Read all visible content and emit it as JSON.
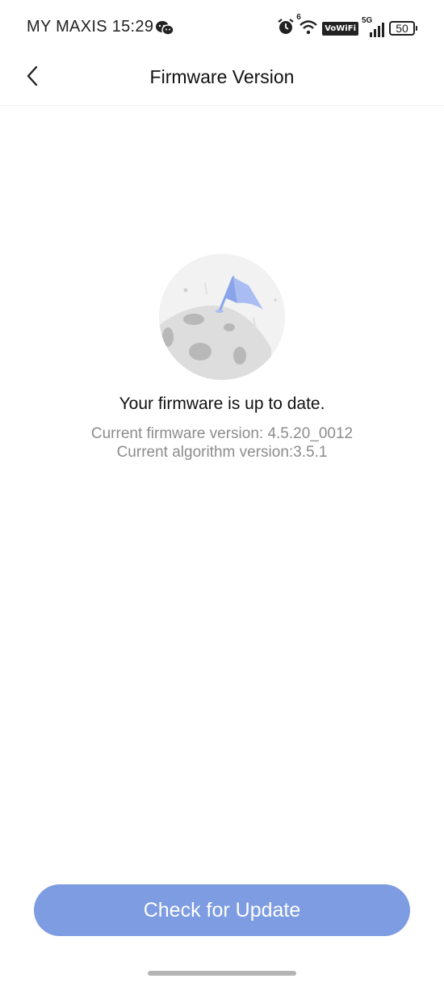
{
  "status_bar": {
    "carrier_time": "MY MAXIS 15:29",
    "network_label": "5G",
    "vowifi_label": "VoWiFi",
    "wifi_badge": "6",
    "battery_level": "50"
  },
  "header": {
    "title": "Firmware Version"
  },
  "main": {
    "status_title": "Your firmware is up to date.",
    "firmware_version": "Current firmware version: 4.5.20_0012",
    "algorithm_version": "Current algorithm version:3.5.1"
  },
  "footer": {
    "update_button_label": "Check for Update"
  },
  "colors": {
    "accent": "#7e9ce1",
    "secondary_text": "#8c8c8c",
    "flag": "#8aa4ea"
  }
}
